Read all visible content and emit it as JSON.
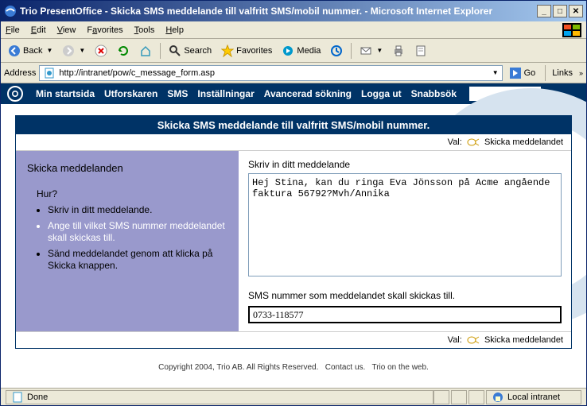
{
  "window": {
    "title": "Trio PresentOffice - Skicka SMS meddelande till valfritt SMS/mobil nummer. - Microsoft Internet Explorer"
  },
  "menubar": {
    "file": "File",
    "edit": "Edit",
    "view": "View",
    "favorites": "Favorites",
    "tools": "Tools",
    "help": "Help"
  },
  "toolbar": {
    "back": "Back",
    "search": "Search",
    "favorites": "Favorites",
    "media": "Media"
  },
  "address": {
    "label": "Address",
    "url": "http://intranet/pow/c_message_form.asp",
    "go": "Go",
    "links": "Links"
  },
  "nav": {
    "startsida": "Min startsida",
    "utforskaren": "Utforskaren",
    "sms": "SMS",
    "installningar": "Inställningar",
    "avancerad": "Avancerad sökning",
    "loggaut": "Logga ut",
    "snabbsok": "Snabbsök"
  },
  "card": {
    "title": "Skicka SMS meddelande till valfritt SMS/mobil nummer.",
    "val_label": "Val:",
    "skicka_link": "Skicka meddelandet"
  },
  "left": {
    "heading": "Skicka meddelanden",
    "hur": "Hur?",
    "step1": "Skriv in ditt meddelande.",
    "step2": "Ange till vilket SMS nummer meddelandet skall skickas till.",
    "step3": "Sänd meddelandet genom att klicka på Skicka knappen."
  },
  "right": {
    "msg_label": "Skriv in ditt meddelande",
    "msg_value": "Hej Stina, kan du ringa Eva Jönsson på Acme angående faktura 56792?Mvh/Annika",
    "num_label": "SMS nummer som meddelandet skall skickas till.",
    "num_value": "0733-118577"
  },
  "footer": {
    "copyright": "Copyright 2004, Trio AB. All Rights Reserved.",
    "contact": "Contact us.",
    "triotxt": "Trio on the web."
  },
  "status": {
    "done": "Done",
    "zone": "Local intranet"
  }
}
